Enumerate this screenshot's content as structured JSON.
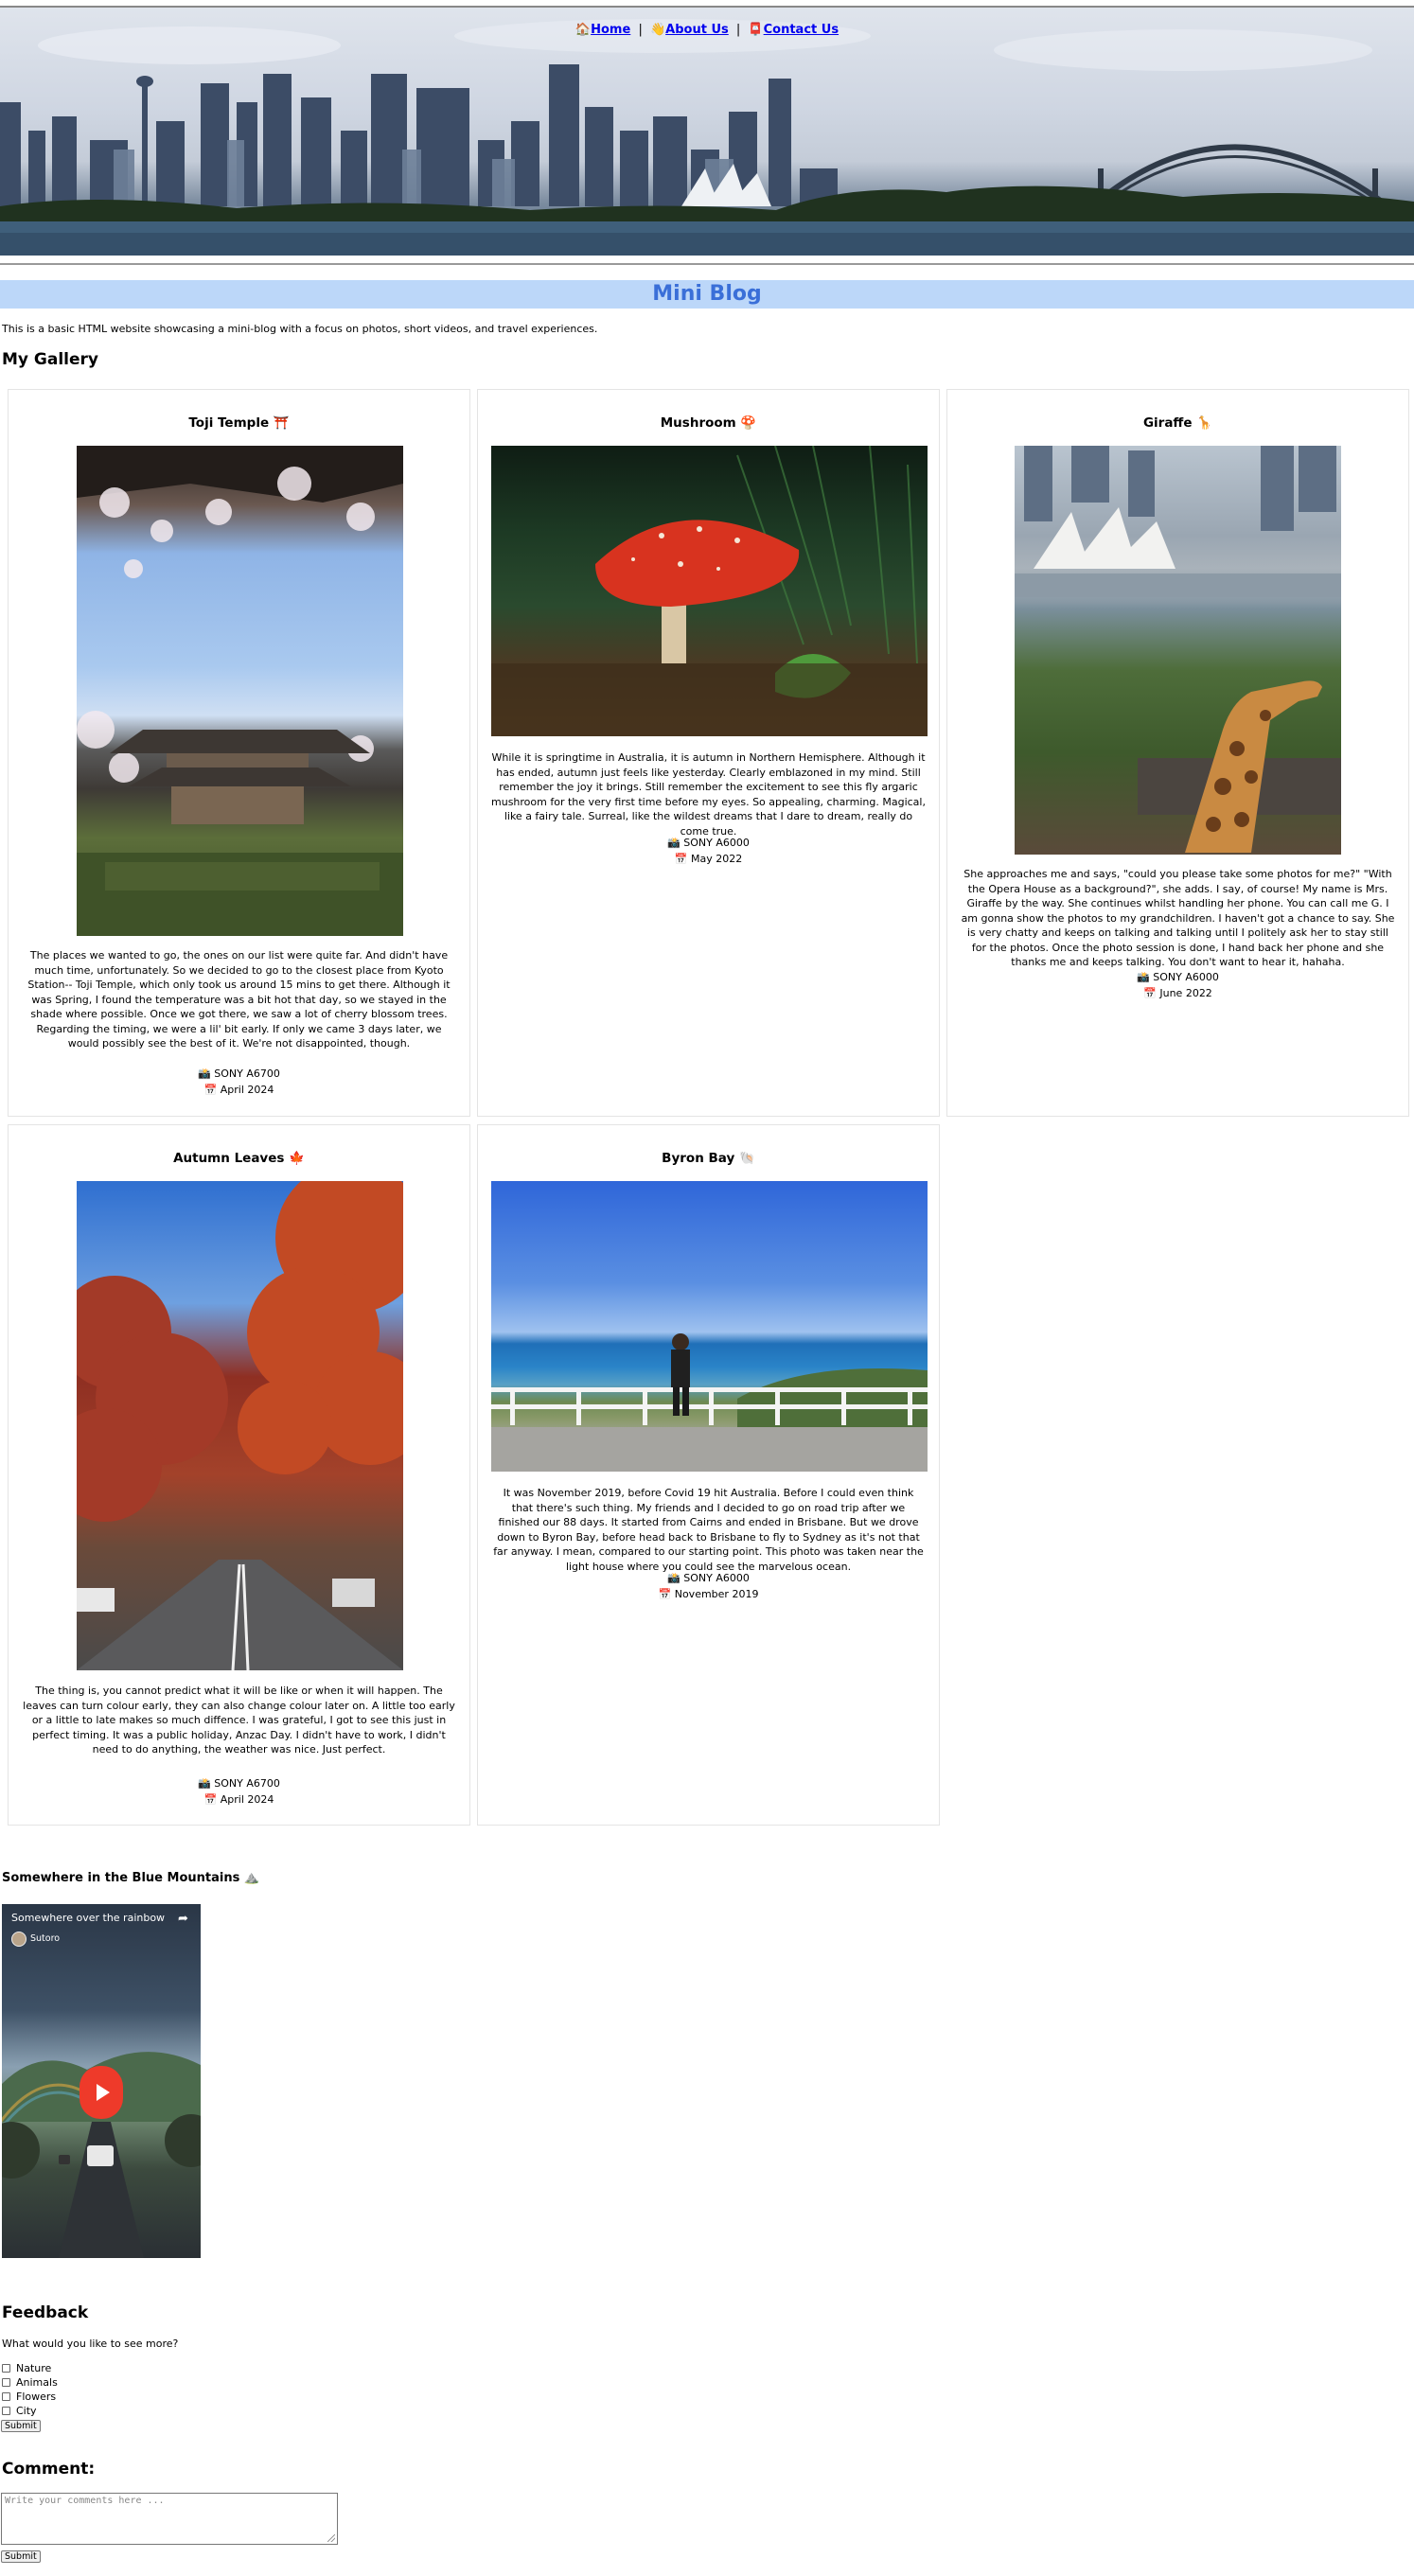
{
  "nav": {
    "home": {
      "icon": "🏠",
      "label": "Home"
    },
    "about": {
      "icon": "👋",
      "label": "About Us"
    },
    "contact": {
      "icon": "📮",
      "label": "Contact Us"
    },
    "separator": "|"
  },
  "site_title": "Mini Blog",
  "intro": "This is a basic HTML website showcasing a mini-blog with a focus on photos, short videos, and travel experiences.",
  "gallery_title": "My Gallery",
  "posts": [
    {
      "title": "Toji Temple ⛩️",
      "description": "The places we wanted to go, the ones on our list were quite far. And didn't have much time, unfortunately. So we decided to go to the closest place from Kyoto Station-- Toji Temple, which only took us around 15 mins to get there. Although it was Spring, I found the temperature was a bit hot that day, so we stayed in the shade where possible. Once we got there, we saw a lot of cherry blossom trees. Regarding the timing, we were a lil' bit early. If only we came 3 days later, we would possibly see the best of it. We're not disappointed, though.",
      "camera": "📸 SONY A6700",
      "date": "📅 April 2024"
    },
    {
      "title": "Mushroom 🍄",
      "description": "While it is springtime in Australia, it is autumn in Northern Hemisphere. Although it has ended, autumn just feels like yesterday. Clearly emblazoned in my mind. Still remember the joy it brings. Still remember the excitement to see this fly argaric mushroom for the very first time before my eyes. So appealing, charming. Magical, like a fairy tale. Surreal, like the wildest dreams that I dare to dream, really do come true.",
      "camera": "📸 SONY A6000",
      "date": "📅 May 2022"
    },
    {
      "title": "Giraffe 🦒",
      "description": "She approaches me and says, \"could you please take some photos for me?\" \"With the Opera House as a background?\", she adds. I say, of course! My name is Mrs. Giraffe by the way. She continues whilst handling her phone. You can call me G. I am gonna show the photos to my grandchildren. I haven't got a chance to say. She is very chatty and keeps on talking and talking until I politely ask her to stay still for the photos. Once the photo session is done, I hand back her phone and she thanks me and keeps talking. You don't want to hear it, hahaha.",
      "camera": "📸 SONY A6000",
      "date": "📅 June 2022"
    },
    {
      "title": "Autumn Leaves 🍁",
      "description": "The thing is, you cannot predict what it will be like or when it will happen. The leaves can turn colour early, they can also change colour later on. A little too early or a little to late makes so much diffence. I was grateful, I got to see this just in perfect timing. It was a public holiday, Anzac Day. I didn't have to work, I didn't need to do anything, the weather was nice. Just perfect.",
      "camera": "📸 SONY A6700",
      "date": "📅 April 2024"
    },
    {
      "title": "Byron Bay 🐚",
      "description": "It was November 2019, before Covid 19 hit Australia. Before I could even think that there's such thing. My friends and I decided to go on road trip after we finished our 88 days. It started from Cairns and ended in Brisbane. But we drove down to Byron Bay, before head back to Brisbane to fly to Sydney as it's not that far anyway. I mean, compared to our starting point. This photo was taken near the light house where you could see the marvelous ocean.",
      "camera": "📸 SONY A6000",
      "date": "📅 November 2019"
    }
  ],
  "video": {
    "section_title": "Somewhere in the Blue Mountains ⛰️",
    "title": "Somewhere over the rainbow",
    "channel": "Sutoro",
    "share_icon": "share-icon",
    "play_icon": "play-icon"
  },
  "feedback": {
    "title": "Feedback",
    "question": "What would you like to see more?",
    "options": [
      "Nature",
      "Animals",
      "Flowers",
      "City"
    ],
    "submit": "Submit"
  },
  "comment": {
    "title": "Comment:",
    "placeholder": "Write your comments here ...",
    "submit": "Submit"
  },
  "colors": {
    "title_bg": "#bcd7f9",
    "title_text": "#3a6fd8",
    "link": "#0000ee"
  }
}
